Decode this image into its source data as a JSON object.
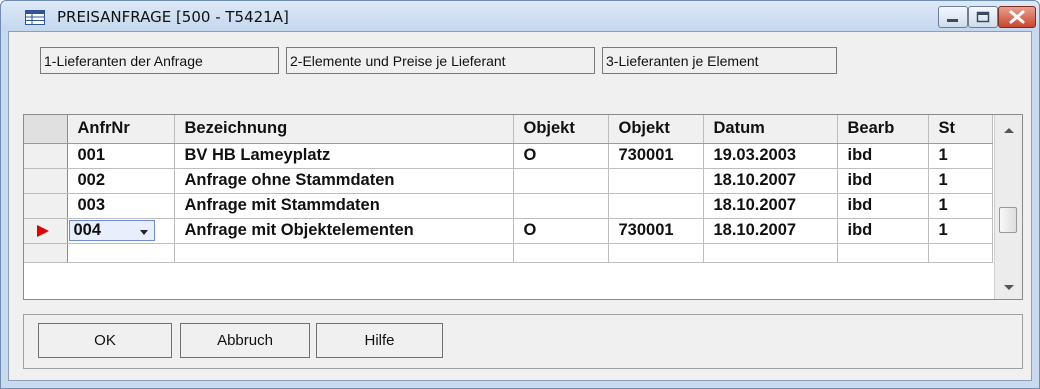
{
  "window": {
    "title": "PREISANFRAGE  [500 - T5421A]",
    "icon": "table-icon",
    "controls": [
      "minimize-icon",
      "maximize-icon",
      "close-icon"
    ]
  },
  "tabs": [
    {
      "label": "1-Lieferanten der Anfrage"
    },
    {
      "label": "2-Elemente und Preise je Lieferant"
    },
    {
      "label": "3-Lieferanten je Element"
    }
  ],
  "grid": {
    "columns": [
      "AnfrNr",
      "Bezeichnung",
      "Objekt",
      "Objekt",
      "Datum",
      "Bearb",
      "St"
    ],
    "rows": [
      [
        "001",
        "BV HB Lameyplatz",
        "O",
        "730001",
        "19.03.2003",
        "ibd",
        "1"
      ],
      [
        "002",
        "Anfrage ohne Stammdaten",
        "",
        "",
        "18.10.2007",
        "ibd",
        "1"
      ],
      [
        "003",
        "Anfrage mit Stammdaten",
        "",
        "",
        "18.10.2007",
        "ibd",
        "1"
      ],
      [
        "004",
        "Anfrage mit Objektelementen",
        "O",
        "730001",
        "18.10.2007",
        "ibd",
        "1"
      ]
    ],
    "current_row_index": 3,
    "colors": {
      "row_marker": "#e00000",
      "edit_cell_bg": "#e8eefc"
    }
  },
  "buttons": {
    "ok": "OK",
    "abbruch": "Abbruch",
    "hilfe": "Hilfe"
  }
}
